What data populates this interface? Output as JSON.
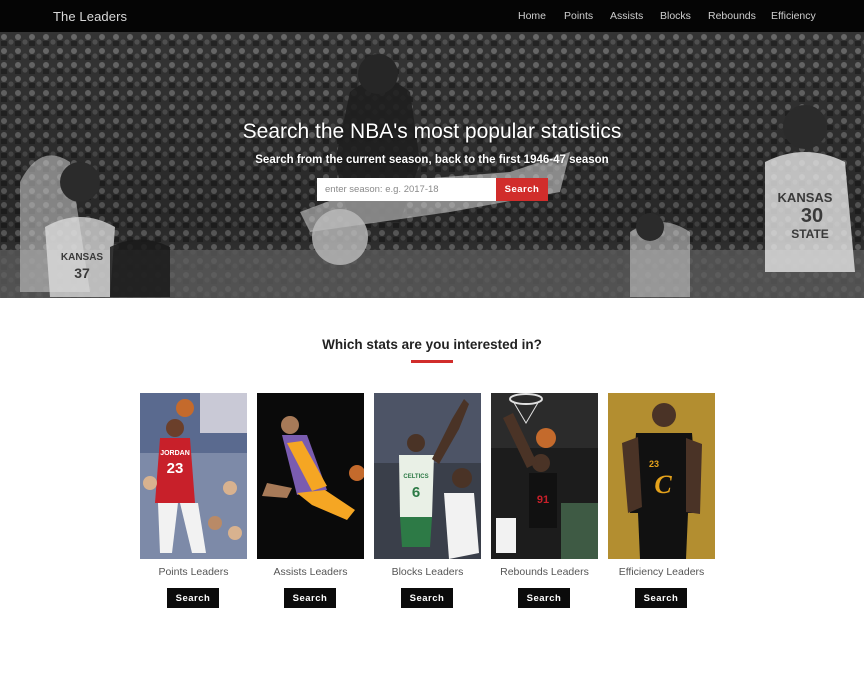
{
  "navbar": {
    "brand": "The Leaders",
    "links": [
      "Home",
      "Points",
      "Assists",
      "Blocks",
      "Rebounds",
      "Efficiency"
    ]
  },
  "hero": {
    "title": "Search the NBA's most popular statistics",
    "subtitle": "Search from the current season, back to the first 1946-47 season",
    "search_placeholder": "enter season: e.g. 2017-18",
    "search_button": "Search",
    "jersey_texts": [
      "KANSAS",
      "30",
      "STATE",
      "KANSAS",
      "37"
    ]
  },
  "section": {
    "title": "Which stats are you interested in?"
  },
  "cards": [
    {
      "label": "Points Leaders",
      "button": "Search",
      "jersey_text": "JORDAN",
      "jersey_number": "23"
    },
    {
      "label": "Assists Leaders",
      "button": "Search",
      "jersey_text": "",
      "jersey_number": ""
    },
    {
      "label": "Blocks Leaders",
      "button": "Search",
      "jersey_text": "CELTICS",
      "jersey_number": "6"
    },
    {
      "label": "Rebounds Leaders",
      "button": "Search",
      "jersey_text": "",
      "jersey_number": "91"
    },
    {
      "label": "Efficiency Leaders",
      "button": "Search",
      "jersey_text": "",
      "jersey_number": "23"
    }
  ],
  "colors": {
    "accent": "#d12d2b",
    "navbar_bg": "#050505",
    "card_button_bg": "#0b0b0b"
  }
}
